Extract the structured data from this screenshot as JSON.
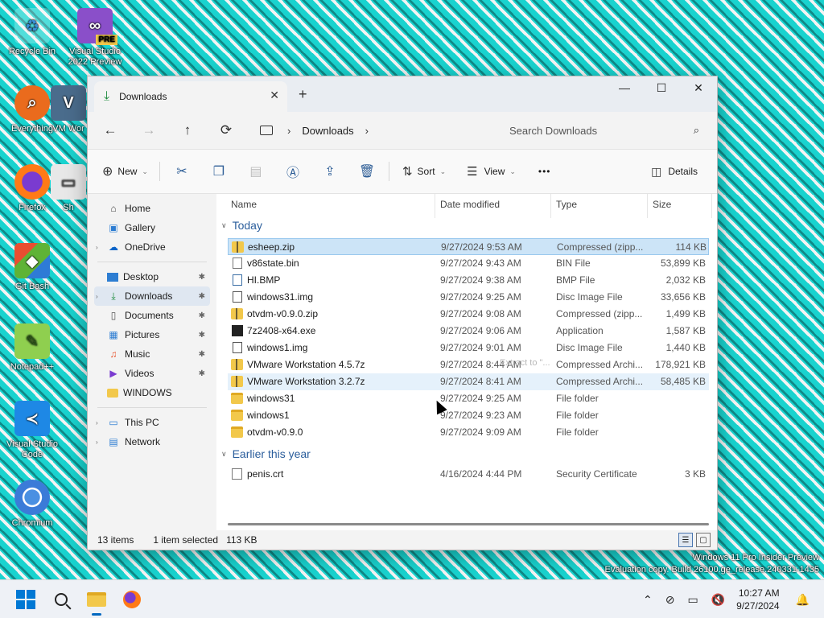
{
  "desktop": {
    "icons": [
      {
        "label": "Recycle Bin",
        "icon": "recycle-bin-icon"
      },
      {
        "label": "Visual Studio 2022 Preview",
        "badge": "PRE",
        "icon": "visual-studio-icon"
      },
      {
        "label": "Everything",
        "icon": "everything-search-icon"
      },
      {
        "label": "VM Wor",
        "icon": "vmware-icon"
      },
      {
        "label": "Firefox",
        "icon": "firefox-icon"
      },
      {
        "label": "Sh",
        "icon": "shortcut-icon"
      },
      {
        "label": "Git Bash",
        "icon": "git-bash-icon"
      },
      {
        "label": "Notepad++",
        "icon": "notepadpp-icon"
      },
      {
        "label": "Visual Studio Code",
        "icon": "vscode-icon"
      },
      {
        "label": "Chromium",
        "icon": "chromium-icon"
      }
    ],
    "watermark_line1": "Windows 11 Pro Insider Preview",
    "watermark_line2": "Evaluation copy. Build 26100.ge_release.240331-1435"
  },
  "window": {
    "tab_title": "Downloads",
    "tab_close": "✕",
    "new_tab": "+",
    "minimize": "—",
    "maximize": "☐",
    "close": "✕"
  },
  "navbar": {
    "back": "←",
    "forward": "→",
    "up": "↑",
    "refresh": "⟳",
    "breadcrumb_current": "Downloads",
    "breadcrumb_sep": "›",
    "search_placeholder": "Search Downloads",
    "search_icon": "⌕"
  },
  "toolbar": {
    "new_label": "New",
    "sort_label": "Sort",
    "view_label": "View",
    "more_label": "•••",
    "details_label": "Details",
    "chev": "⌄"
  },
  "navpane": {
    "quick": [
      {
        "label": "Home",
        "icon": "home-icon"
      },
      {
        "label": "Gallery",
        "icon": "gallery-icon"
      },
      {
        "label": "OneDrive",
        "icon": "onedrive-icon"
      }
    ],
    "pinned": [
      {
        "label": "Desktop",
        "icon": "desktop-folder-icon",
        "pinned": true
      },
      {
        "label": "Downloads",
        "icon": "downloads-folder-icon",
        "pinned": true,
        "active": true
      },
      {
        "label": "Documents",
        "icon": "documents-folder-icon",
        "pinned": true
      },
      {
        "label": "Pictures",
        "icon": "pictures-folder-icon",
        "pinned": true
      },
      {
        "label": "Music",
        "icon": "music-folder-icon",
        "pinned": true
      },
      {
        "label": "Videos",
        "icon": "videos-folder-icon",
        "pinned": true
      },
      {
        "label": "WINDOWS",
        "icon": "folder-icon",
        "pinned": false
      }
    ],
    "bottom": [
      {
        "label": "This PC",
        "icon": "this-pc-icon"
      },
      {
        "label": "Network",
        "icon": "network-icon"
      }
    ],
    "pin_glyph": "📌"
  },
  "columns": {
    "name": "Name",
    "date": "Date modified",
    "type": "Type",
    "size": "Size"
  },
  "groups": [
    {
      "title": "Today",
      "files": [
        {
          "name": "esheep.zip",
          "date": "9/27/2024 9:53 AM",
          "type": "Compressed (zipp...",
          "size": "114 KB",
          "kind": "zip",
          "selected": true
        },
        {
          "name": "v86state.bin",
          "date": "9/27/2024 9:43 AM",
          "type": "BIN File",
          "size": "53,899 KB",
          "kind": "doc"
        },
        {
          "name": "HI.BMP",
          "date": "9/27/2024 9:38 AM",
          "type": "BMP File",
          "size": "2,032 KB",
          "kind": "bmp"
        },
        {
          "name": "windows31.img",
          "date": "9/27/2024 9:25 AM",
          "type": "Disc Image File",
          "size": "33,656 KB",
          "kind": "img"
        },
        {
          "name": "otvdm-v0.9.0.zip",
          "date": "9/27/2024 9:08 AM",
          "type": "Compressed (zipp...",
          "size": "1,499 KB",
          "kind": "zip"
        },
        {
          "name": "7z2408-x64.exe",
          "date": "9/27/2024 9:06 AM",
          "type": "Application",
          "size": "1,587 KB",
          "kind": "exe"
        },
        {
          "name": "windows1.img",
          "date": "9/27/2024 9:01 AM",
          "type": "Disc Image File",
          "size": "1,440 KB",
          "kind": "img"
        },
        {
          "name": "VMware Workstation 4.5.7z",
          "date": "9/27/2024 8:44 AM",
          "type": "Compressed Archi...",
          "size": "178,921 KB",
          "kind": "zip"
        },
        {
          "name": "VMware Workstation 3.2.7z",
          "date": "9/27/2024 8:41 AM",
          "type": "Compressed Archi...",
          "size": "58,485 KB",
          "kind": "zip",
          "hover": true
        },
        {
          "name": "windows31",
          "date": "9/27/2024 9:25 AM",
          "type": "File folder",
          "size": "",
          "kind": "folder"
        },
        {
          "name": "windows1",
          "date": "9/27/2024 9:23 AM",
          "type": "File folder",
          "size": "",
          "kind": "folder"
        },
        {
          "name": "otvdm-v0.9.0",
          "date": "9/27/2024 9:09 AM",
          "type": "File folder",
          "size": "",
          "kind": "folder"
        }
      ]
    },
    {
      "title": "Earlier this year",
      "files": [
        {
          "name": "penis.crt",
          "date": "4/16/2024 4:44 PM",
          "type": "Security Certificate",
          "size": "3 KB",
          "kind": "crt"
        }
      ]
    }
  ],
  "drag_ghost": "Extract to \"...",
  "status": {
    "items": "13 items",
    "selected": "1 item selected",
    "size": "113 KB"
  },
  "taskbar": {
    "apps": [
      {
        "name": "start-button",
        "glyph": "⊞"
      },
      {
        "name": "search-button",
        "glyph": "⚲"
      },
      {
        "name": "file-explorer-taskbar",
        "glyph": "📁"
      },
      {
        "name": "firefox-taskbar",
        "glyph": "●"
      }
    ],
    "tray_chevron": "⌃",
    "time": "10:27 AM",
    "date": "9/27/2024"
  },
  "colors": {
    "accent": "#0067c0",
    "selection": "#cce4f7",
    "group_header": "#2b5e9c"
  }
}
